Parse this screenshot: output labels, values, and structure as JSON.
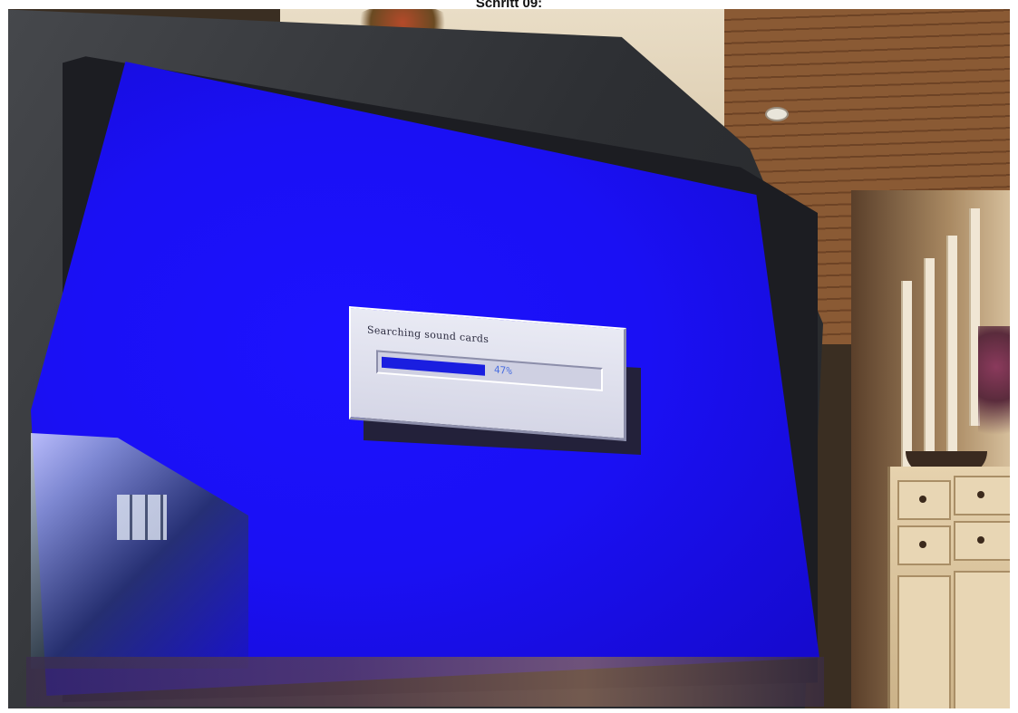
{
  "caption": "Schritt 09:",
  "dialog": {
    "title": "Searching sound cards",
    "progress_percent": 47,
    "progress_label": "47%"
  },
  "colors": {
    "screen": "#1a10f4",
    "dialog_bg": "#e0e1ef",
    "progress_fill": "#1a1ee0"
  }
}
